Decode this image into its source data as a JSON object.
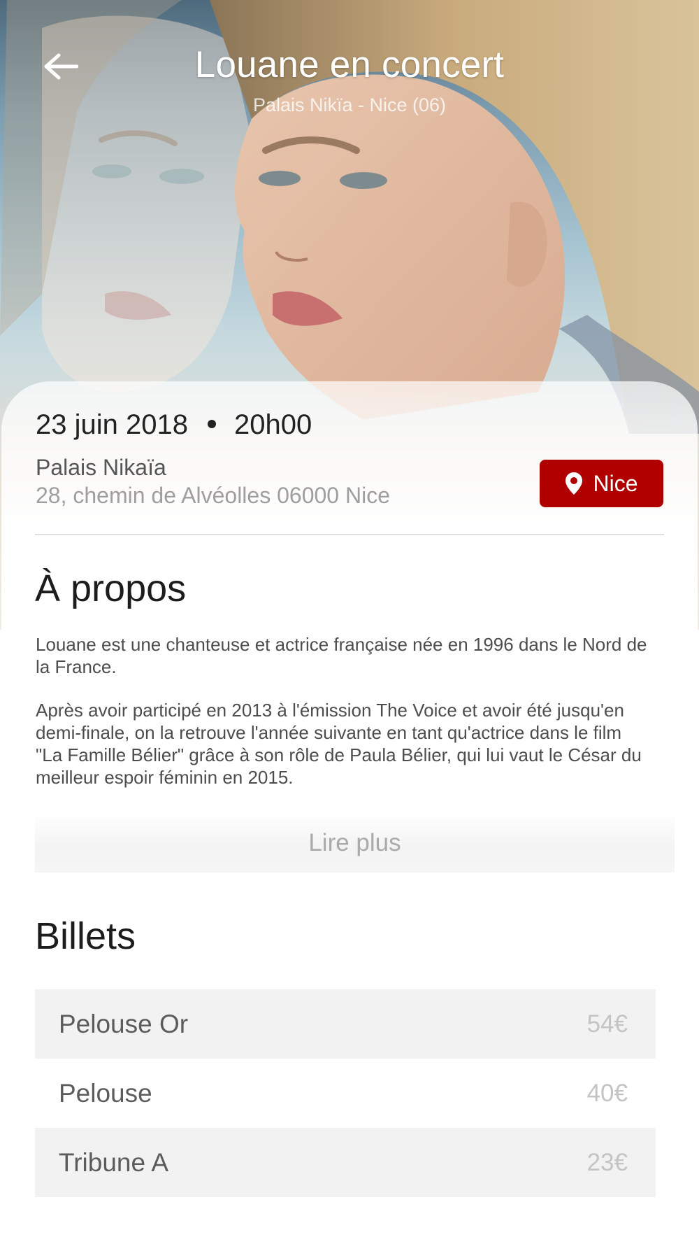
{
  "header": {
    "title": "Louane en concert",
    "subtitle": "Palais Nikïa - Nice (06)",
    "back_icon": "arrow-left-icon"
  },
  "event": {
    "date": "23 juin 2018",
    "time": "20h00",
    "venue_name": "Palais Nikaïa",
    "venue_address": "28, chemin de Alvéolles 06000 Nice",
    "location_button_label": "Nice",
    "location_icon": "map-pin-icon",
    "accent_color": "#b00000"
  },
  "about": {
    "title": "À propos",
    "paragraphs": [
      "Louane est une chanteuse et actrice française née en 1996 dans le Nord de la France.",
      "Après avoir participé en 2013 à l'émission The Voice et avoir été jusqu'en demi-finale, on la retrouve l'année suivante en tant qu'actrice dans le film \"La Famille Bélier\" grâce à son rôle de Paula Bélier, qui lui vaut le César du meilleur espoir féminin en 2015."
    ],
    "read_more_label": "Lire plus"
  },
  "tickets": {
    "title": "Billets",
    "items": [
      {
        "name": "Pelouse Or",
        "price": "54€"
      },
      {
        "name": "Pelouse",
        "price": "40€"
      },
      {
        "name": "Tribune A",
        "price": "23€"
      }
    ]
  }
}
